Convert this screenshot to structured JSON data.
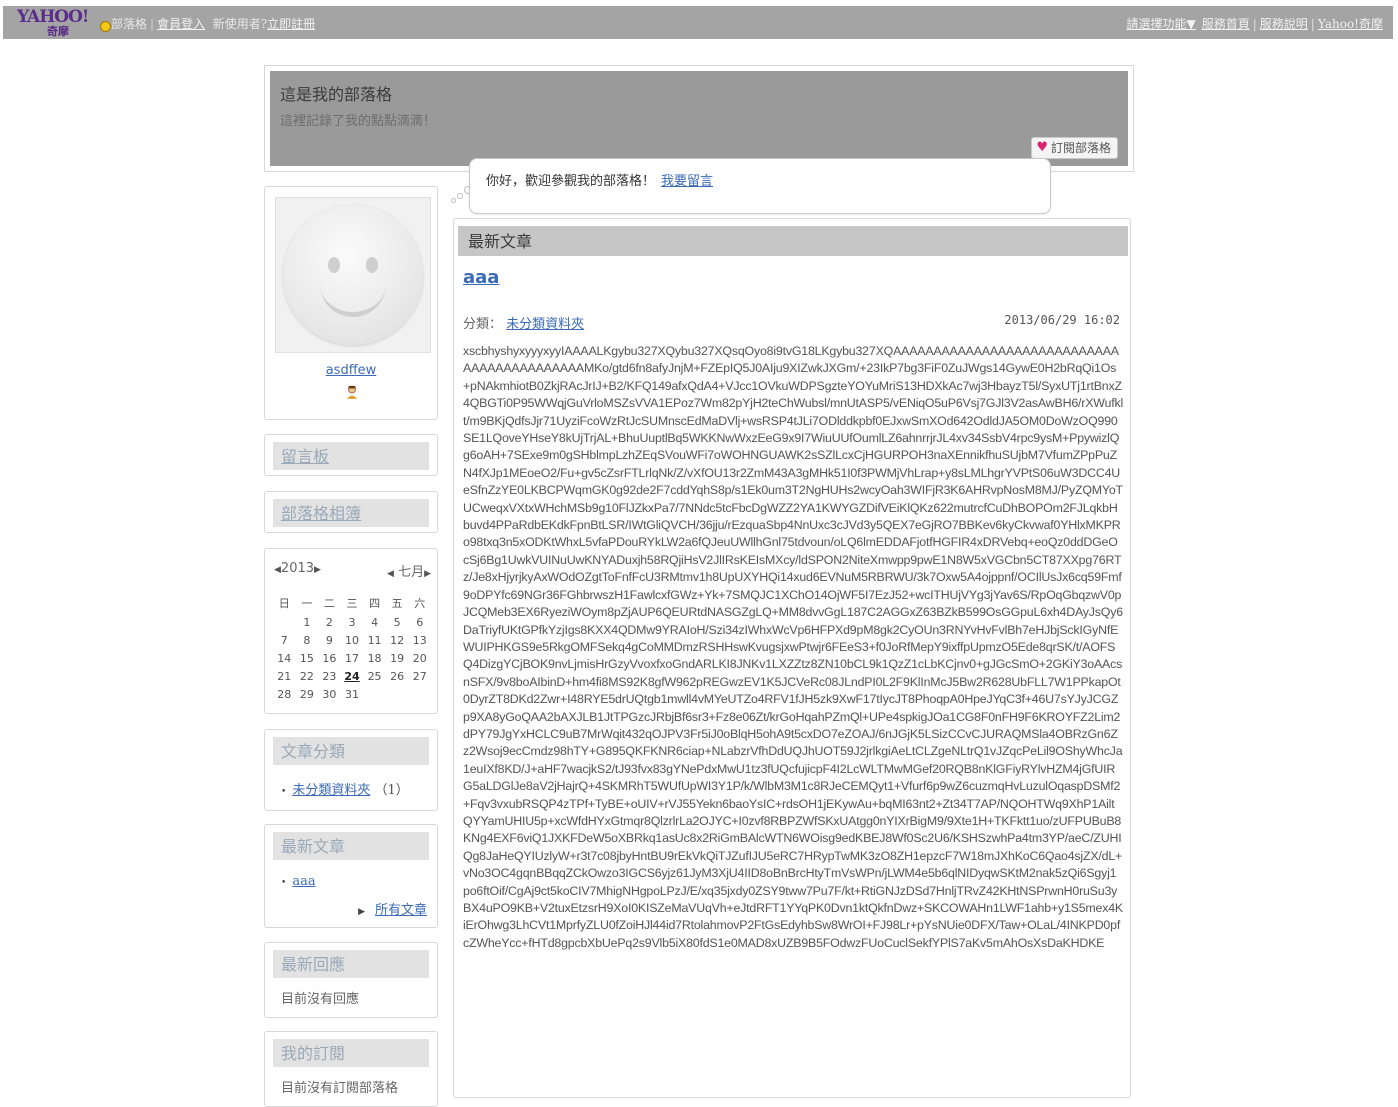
{
  "topbar": {
    "logo_text": "YAHOO!",
    "logo_sub": "奇摩",
    "nav_blog": "部落格",
    "nav_login": "會員登入",
    "nav_new_user": "新使用者?",
    "nav_register": "立即註冊",
    "right_links": [
      "請選擇功能▼",
      "服務首頁",
      "服務說明",
      "Yahoo!奇摩"
    ]
  },
  "header": {
    "title": "這是我的部落格",
    "description": "這裡記錄了我的點點滴滴！",
    "subscribe_label": "訂閱部落格"
  },
  "bubble": {
    "text": "你好，歡迎參觀我的部落格！",
    "link": "我要留言"
  },
  "profile": {
    "username": "asdffew"
  },
  "sidebar": {
    "guestbook": "留言板",
    "blog_links": "部落格相簿",
    "calendar": {
      "year": "2013",
      "month": "七月",
      "weekdays": [
        "日",
        "一",
        "二",
        "三",
        "四",
        "五",
        "六"
      ],
      "days": [
        "",
        "1",
        "2",
        "3",
        "4",
        "5",
        "6",
        "7",
        "8",
        "9",
        "10",
        "11",
        "12",
        "13",
        "14",
        "15",
        "16",
        "17",
        "18",
        "19",
        "20",
        "21",
        "22",
        "23",
        "24",
        "25",
        "26",
        "27",
        "28",
        "29",
        "30",
        "31"
      ],
      "today": "24"
    },
    "categories": {
      "title": "文章分類",
      "items": [
        {
          "label": "未分類資料夾",
          "count": "（1）"
        }
      ]
    },
    "latest_posts": {
      "title": "最新文章",
      "items": [
        "aaa"
      ],
      "more": "所有文章"
    },
    "latest_replies": {
      "title": "最新回應",
      "empty": "目前沒有回應"
    },
    "my_subscriptions": {
      "title": "我的訂閱",
      "empty": "目前沒有訂閱部落格"
    }
  },
  "main": {
    "section_title": "最新文章",
    "post": {
      "title": "aaa",
      "category_label": "分類：",
      "category": "未分類資料夾",
      "date": "2013/06/29 16:02",
      "body": "xscbhyshyxyyyxyyIAAAALKgybu327XQybu327XQsqOyo8i9tvG18LKgybu327XQAAAAAAAAAAAAAAAAAAAAAAAAAAAAAAAAAAAAAAAAAAAMKo/gtd6fn8afyJnjM+FZEpIQ5J0AIju9XIZwkJXGm/+23IkP7bg3FiF0ZuJWgs14GywE0H2bRqQi1Os+pNAkmhiotB0ZkjRAcJrIJ+B2/KFQ149afxQdA4+VJcc1OVkuWDPSgzteYOYuMriS13HDXkAc7wj3HbayzT5l/SyxUTj1rtBnxZ4QBGTi0P95WWqjGuVrloMSZsVVA1EPoz7Wm82pYjH2teChWubsl/mnUtASP5/vENiqO5uP6Vsj7GJl3V2asAwBH6/rXWufklt/m9BKjQdfsJjr71UyziFcoWzRtJcSUMnscEdMaDVlj+wsRSP4tJLi7ODlddkpbf0EJxwSmXOd642OdldJA5OM0DoWzOQ990SE1LQoveYHseY8kUjTrjAL+BhuUuptlBq5WKKNwWxzEeG9x9I7WiuUUfOumlLZ6ahnrrjrJL4xv34SsbV4rpc9ysM+PpywizlQg6oAH+7SExe9m0gSHblmpLzhZEqSVouWFi7oWOHNGUAWK2sSZlLcxCjHGURPOH3naXEnnikfhuSUjbM7VfumZPpPuZN4fXJp1MEoeO2/Fu+gv5cZsrFTLrlqNk/Z/vXfOU13r2ZmM43A3gMHk51I0f3PWMjVhLrap+y8sLMLhgrYVPtS06uW3DCC4UeSfnZzYE0LKBCPWqmGK0g92de2F7cddYqhS8p/s1Ek0um3T2NgHUHs2wcyOah3WIFjR3K6AHRvpNosM8MJ/PyZQMYoTUCweqxVXtxWHchMSb9g10FlJZkxPa7/7NNdc5tcFbcDgWZZ2YA1KWYGZDifVEiKlQKz622mutrcfCuDhBOPOm2FJLqkbHbuvd4PPaRdbEKdkFpnBtLSR/IWtGliQVCH/36jju/rEzquaSbp4NnUxc3cJVd3y5QEX7eGjRO7BBKev6kyCkvwaf0YHlxMKPRo98txq3n5xODKtWhxL5vfaPDouRYkLW2a6fQJeuUWllhGnl75tdvoun/oLQ6lmEDDAFjotfHGFIR4xDRVebq+eoQz0ddDGeOcSj6Bg1UwkVUINuUwKNYADuxjh58RQjiHsV2JlIRsKEIsMXcy/ldSPON2NiteXmwpp9pwE1N8W5xVGCbn5CT87XXpg76RTz/Je8xHjyrjkyAxWOdOZgtToFnfFcU3RMtmv1h8UpUXYHQi14xud6EVNuM5RBRWU/3k7Oxw5A4ojppnf/OCIlUsJx6cq59Fmf9oDPYfc69NGr36FGhbrwszH1FawlcxfGWz+Yk+7SMQJC1XChO14OjWF5I7EzJ52+wcITHUjVYg3jYav6S/RpOqGbqzwV0pJCQMeb3EX6RyeziWOym8pZjAUP6QEURtdNASGZgLQ+MM8dvvGgL187C2AGGxZ63BZkB599OsGGpuL6xh4DAyJsQy6DaTriyfUKtGPfkYzjIgs8KXX4QDMw9YRAIoH/Szi34zIWhxWcVp6HFPXd9pM8gk2CyOUn3RNYvHvFvlBh7eHJbjSckIGyNfEWUIPHKGS9e5RkgOMFSekq4gCoMMDmzRSHHswKvugsjxwPtwjr6FEeS3+f0JoRfMepY9ixffpUpmzO5Ede8qrSK/t/AOFSQ4DizgYCjBOK9nvLjmisHrGzyVvoxfxoGndARLKI8JNKv1LXZZtz8ZN10bCL9k1QzZ1cLbKCjnv0+gJGcSmO+2GKiY3oAAcsnSFX/9v8boAIbinD+hm4fi8MS92K8gfW962pREGwzEV1K5JCVeRc08JLndPI0L2F9KlInMcJ5Bw2R628UbFLL7W1PPkapOt0DyrZT8DKd2Zwr+I48RYE5drUQtgb1mwll4vMYeUTZo4RFV1fJH5zk9XwF17tIycJT8PhoqpA0HpeJYqC3f+46U7sYJyJCGZp9XA8yGoQAA2bAXJLB1JtTPGzcJRbjBf6sr3+Fz8e06Zt/krGoHqahPZmQl+UPe4spkigJOa1CG8F0nFH9F6KROYFZ2Lim2dPY79JgYxHCLC9uB7MrWqit432qOJPV3Fr5iJ0oBlqH5ohA9t5cxDO7eZOAJ/6nJGjK5LSizCCvCJURAQMSla4OBRzGn6Zz2Wsoj9ecCmdz98hTY+G895QKFKNR6ciap+NLabzrVfhDdUQJhUOT59J2jrlkgiAeLtCLZgeNLtrQ1vJZqcPeLil9OShyWhcJa1euIXf8KD/J+aHF7wacjkS2/tJ93fvx83gYNePdxMwU1tz3fUQcfujicpF4I2LcWLTMwMGef20RQB8nKlGFiyRYlvHZM4jGfUIRG5aLDGlJe8aV2jHajrQ+4SKMRhT5WUfUpWI3Y1P/k/WlbM3M1c8RJeCEMQyt1+Vfurf6p9wZ6cuzmqHvLuzulOqaspDSMf2+Fqv3vxubRSQP4zTPf+TyBE+oUIV+rVJ55Yekn6baoYsIC+rdsOH1jEKywAu+bqMI63nt2+Zt34T7AP/NQOHTWq9XhP1AiltQYYamUHIU5p+xcWfdHYxGtmqr8QlzrlrLa2OJYC+I0zvf8RBPZWfSKxUAtgg0nYIXrBigM9/9Xte1H+TKFktt1uo/zUFPUBuB8KNg4EXF6viQ1JXKFDeW5oXBRkq1asUc8x2RiGmBAlcWTN6WOisg9edKBEJ8Wf0Sc2U6/KSHSzwhPa4tm3YP/aeC/ZUHIQg8JaHeQYIUzlyW+r3t7c08jbyHntBU9rEkVkQiTJZufIJU5eRC7HRypTwMK3zO8ZH1epzcF7W18mJXhKoC6Qao4sjZX/dL+vNo3OC4gqnBBqqZCkOwzo3IGCS6yjz61JyM3XjU4IID8oBnBrcHtyTmVsWPn/jLWM4e5b6qlNIDyqwSKtM2nak5zQi6Sgyj1po6ftOif/CgAj9ct5koCIV7MhigNHgpoLPzJ/E/xq35jxdy0ZSY9tww7Pu7F/kt+RtiGNJzDSd7HnljTRvZ42KHtNSPrwnH0ruSu3yBX4uPO9KB+V2tuxEtzsrH9XoI0KISZeMaVUqVh+eJtdRFT1YYqPK0Dvn1ktQkfnDwz+SKCOWAHn1LWF1ahb+y1S5mex4KiErOhwg3LhCVt1MprfyZLU0fZoiHJl44id7RtolahmovP2FtGsEdyhbSw8WrOI+FJ98Lr+pYsNUie0DFX/Taw+OLaL/4INKPD0pfcZWheYcc+fHTd8gpcbXbUePq2s9Vlb5iX80fdS1e0MAD8xUZB9B5FOdwzFUoCuclSekfYPlS7aKv5mAhOsXsDaKHDKE"
    }
  }
}
